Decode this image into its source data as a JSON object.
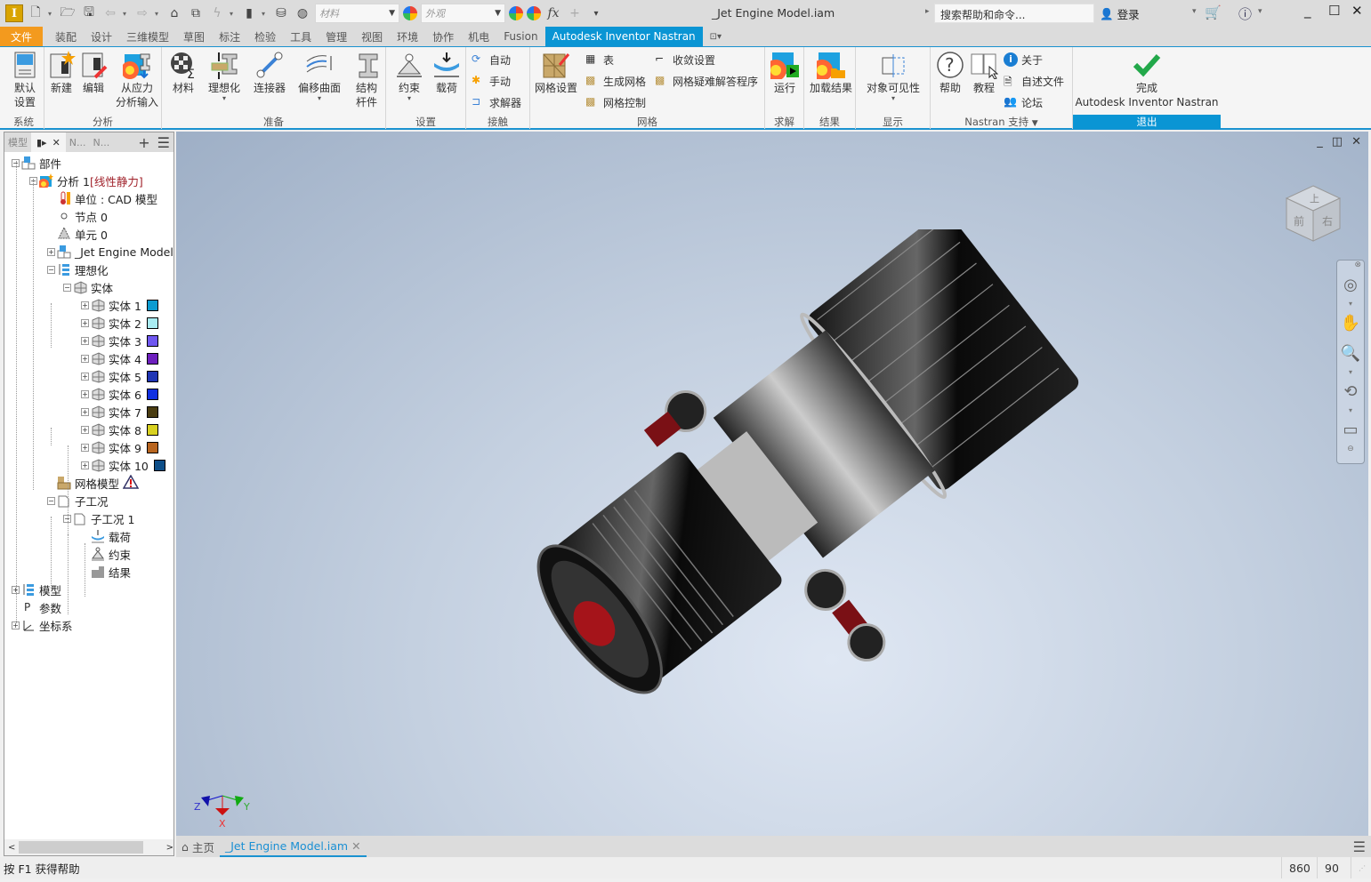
{
  "app": {
    "title": "_Jet Engine Model.iam",
    "logo_letter": "I"
  },
  "quick_access": {
    "material_placeholder": "材料",
    "appearance_placeholder": "外观",
    "search_placeholder": "搜索帮助和命令...",
    "login_label": "登录"
  },
  "ribbon_tabs": [
    {
      "label": "文件",
      "kind": "file"
    },
    {
      "label": "装配"
    },
    {
      "label": "设计"
    },
    {
      "label": "三维模型"
    },
    {
      "label": "草图"
    },
    {
      "label": "标注"
    },
    {
      "label": "检验"
    },
    {
      "label": "工具"
    },
    {
      "label": "管理"
    },
    {
      "label": "视图"
    },
    {
      "label": "环境"
    },
    {
      "label": "协作"
    },
    {
      "label": "机电"
    },
    {
      "label": "Fusion"
    },
    {
      "label": "Autodesk Inventor Nastran",
      "active": true
    }
  ],
  "ribbon": {
    "groups": {
      "system": "系统",
      "analysis": "分析",
      "prepare": "准备",
      "setup": "设置",
      "contact": "接触",
      "mesh": "网格",
      "solve": "求解",
      "results": "结果",
      "display": "显示",
      "support": "Nastran 支持",
      "exit": "退出"
    },
    "buttons": {
      "default_settings": "默认\n设置",
      "default_settings_l1": "默认",
      "default_settings_l2": "设置",
      "new": "新建",
      "edit": "编辑",
      "import_stress_l1": "从应力",
      "import_stress_l2": "分析输入",
      "materials": "材料",
      "idealization": "理想化",
      "connectors": "连接器",
      "offset_surface": "偏移曲面",
      "structural_l1": "结构",
      "structural_l2": "杆件",
      "constraints": "约束",
      "loads": "载荷",
      "auto": "自动",
      "manual": "手动",
      "solver": "求解器",
      "mesh_settings": "网格设置",
      "table": "表",
      "generate_mesh": "生成网格",
      "mesh_control": "网格控制",
      "convergence": "收敛设置",
      "mesh_troubleshooter": "网格疑难解答程序",
      "run": "运行",
      "load_results": "加载结果",
      "object_visibility": "对象可见性",
      "help": "帮助",
      "tutorial": "教程",
      "about": "关于",
      "readme": "自述文件",
      "forum": "论坛",
      "finish_l1": "完成",
      "finish_l2": "Autodesk Inventor Nastran"
    }
  },
  "browser": {
    "tabs": [
      "模型",
      "N...",
      "N..."
    ],
    "tree": [
      {
        "label": "部件",
        "level": 0,
        "expander": "-",
        "icon": "assembly-icon"
      },
      {
        "label": "分析 1",
        "suffix": "[线性静力]",
        "level": 1,
        "expander": "-",
        "icon": "analysis-icon"
      },
      {
        "label": "单位 : CAD 模型",
        "level": 2,
        "icon": "units-icon"
      },
      {
        "label": "节点 0",
        "level": 2,
        "icon": "node-icon"
      },
      {
        "label": "单元 0",
        "level": 2,
        "icon": "element-icon"
      },
      {
        "label": "_Jet Engine Model.",
        "level": 2,
        "expander": "+",
        "icon": "assembly-icon"
      },
      {
        "label": "理想化",
        "level": 2,
        "expander": "-",
        "icon": "idealization-icon"
      },
      {
        "label": "实体",
        "level": 3,
        "expander": "-",
        "icon": "solid-icon"
      },
      {
        "label": "实体 1",
        "level": 4,
        "expander": "+",
        "icon": "solid-icon",
        "color": "#0b9bd0"
      },
      {
        "label": "实体 2",
        "level": 4,
        "expander": "+",
        "icon": "solid-icon",
        "color": "#a9ecf2"
      },
      {
        "label": "实体 3",
        "level": 4,
        "expander": "+",
        "icon": "solid-icon",
        "color": "#6f57f0"
      },
      {
        "label": "实体 4",
        "level": 4,
        "expander": "+",
        "icon": "solid-icon",
        "color": "#6d1fbd"
      },
      {
        "label": "实体 5",
        "level": 4,
        "expander": "+",
        "icon": "solid-icon",
        "color": "#1f35b4"
      },
      {
        "label": "实体 6",
        "level": 4,
        "expander": "+",
        "icon": "solid-icon",
        "color": "#1030e0"
      },
      {
        "label": "实体 7",
        "level": 4,
        "expander": "+",
        "icon": "solid-icon",
        "color": "#4a3d12"
      },
      {
        "label": "实体 8",
        "level": 4,
        "expander": "+",
        "icon": "solid-icon",
        "color": "#d8d120"
      },
      {
        "label": "实体 9",
        "level": 4,
        "expander": "+",
        "icon": "solid-icon",
        "color": "#b8651f"
      },
      {
        "label": "实体 10",
        "level": 4,
        "expander": "+",
        "icon": "solid-icon",
        "color": "#0d4e88"
      },
      {
        "label": "网格模型",
        "level": 2,
        "icon": "mesh-model-icon",
        "warning": true
      },
      {
        "label": "子工况",
        "level": 2,
        "expander": "-",
        "icon": "subcase-icon"
      },
      {
        "label": "子工况 1",
        "level": 3,
        "expander": "-",
        "icon": "subcase-icon"
      },
      {
        "label": "载荷",
        "level": 4,
        "icon": "load-icon"
      },
      {
        "label": "约束",
        "level": 4,
        "icon": "constraint-icon"
      },
      {
        "label": "结果",
        "level": 4,
        "icon": "results-icon"
      },
      {
        "label": "模型",
        "level": 0,
        "expander": "+",
        "icon": "model-icon"
      },
      {
        "label": "参数",
        "level": 0,
        "icon": "parameters-icon",
        "glyph": "P"
      },
      {
        "label": "坐标系",
        "level": 0,
        "expander": "+",
        "icon": "coordinate-system-icon"
      }
    ]
  },
  "viewport": {
    "viewcube_faces": {
      "top": "上",
      "front": "前",
      "right": "右"
    },
    "triad": {
      "x": "X",
      "y": "Y",
      "z": "Z"
    }
  },
  "doc_tabs": {
    "home": "主页",
    "active": "_Jet Engine Model.iam"
  },
  "status": {
    "help_text": "按 F1 获得帮助",
    "value1": "860",
    "value2": "90"
  },
  "colors": {
    "accent": "#0a95d4",
    "file_tab": "#f39a1e",
    "finish_green": "#22a84a"
  }
}
